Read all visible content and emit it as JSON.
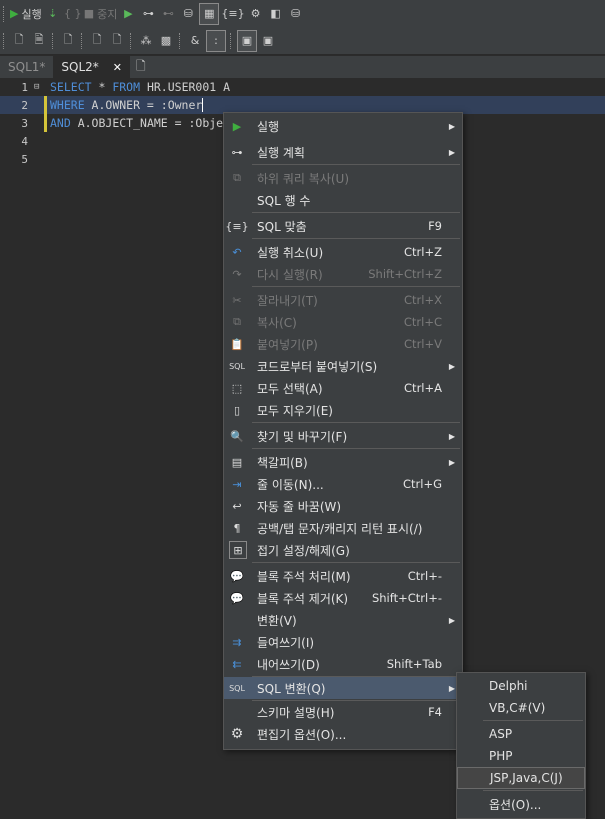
{
  "toolbar1": {
    "run_label": "실행",
    "stop_label": "중지"
  },
  "toolbar2": {
    "amp_label": "&",
    "colon_label": ":"
  },
  "tabs": [
    {
      "label": "SQL1*",
      "active": false
    },
    {
      "label": "SQL2*",
      "active": true
    }
  ],
  "editor": {
    "lines": [
      {
        "num": "1",
        "kw1": "SELECT",
        "t1": " * ",
        "kw2": "FROM",
        "t2": " HR.USER001 A"
      },
      {
        "num": "2",
        "kw1": "WHERE",
        "t1": " A.OWNER = :Owner",
        "kw2": "",
        "t2": ""
      },
      {
        "num": "3",
        "kw1": "AND",
        "t1": " A.OBJECT_NAME = :Obje",
        "kw2": "",
        "t2": ""
      },
      {
        "num": "4",
        "kw1": "",
        "t1": "",
        "kw2": "",
        "t2": ""
      },
      {
        "num": "5",
        "kw1": "",
        "t1": "",
        "kw2": "",
        "t2": ""
      }
    ]
  },
  "context_menu": {
    "items": [
      {
        "label": "실행",
        "shortcut": "",
        "submenu": true,
        "disabled": false,
        "icon": "play-icon"
      },
      {
        "label": "실행 계획",
        "shortcut": "",
        "submenu": true,
        "disabled": false,
        "icon": "plan-icon"
      },
      {
        "label": "하위 쿼리 복사(U)",
        "shortcut": "",
        "submenu": false,
        "disabled": true,
        "icon": "subquery-copy-icon"
      },
      {
        "label": "SQL 행 수",
        "shortcut": "",
        "submenu": false,
        "disabled": false,
        "icon": ""
      },
      {
        "label": "SQL 맞춤",
        "shortcut": "F9",
        "submenu": false,
        "disabled": false,
        "icon": "format-icon"
      },
      {
        "label": "실행 취소(U)",
        "shortcut": "Ctrl+Z",
        "submenu": false,
        "disabled": false,
        "icon": "undo-icon"
      },
      {
        "label": "다시 실행(R)",
        "shortcut": "Shift+Ctrl+Z",
        "submenu": false,
        "disabled": true,
        "icon": "redo-icon"
      },
      {
        "label": "잘라내기(T)",
        "shortcut": "Ctrl+X",
        "submenu": false,
        "disabled": true,
        "icon": "cut-icon"
      },
      {
        "label": "복사(C)",
        "shortcut": "Ctrl+C",
        "submenu": false,
        "disabled": true,
        "icon": "copy-icon"
      },
      {
        "label": "붙여넣기(P)",
        "shortcut": "Ctrl+V",
        "submenu": false,
        "disabled": true,
        "icon": "paste-icon"
      },
      {
        "label": "코드로부터 붙여넣기(S)",
        "shortcut": "",
        "submenu": true,
        "disabled": false,
        "icon": "paste-code-icon"
      },
      {
        "label": "모두 선택(A)",
        "shortcut": "Ctrl+A",
        "submenu": false,
        "disabled": false,
        "icon": "select-all-icon"
      },
      {
        "label": "모두 지우기(E)",
        "shortcut": "",
        "submenu": false,
        "disabled": false,
        "icon": "clear-icon"
      },
      {
        "label": "찾기 및 바꾸기(F)",
        "shortcut": "",
        "submenu": true,
        "disabled": false,
        "icon": "search-icon"
      },
      {
        "label": "책갈피(B)",
        "shortcut": "",
        "submenu": true,
        "disabled": false,
        "icon": "bookmark-icon"
      },
      {
        "label": "줄 이동(N)...",
        "shortcut": "Ctrl+G",
        "submenu": false,
        "disabled": false,
        "icon": "goto-line-icon"
      },
      {
        "label": "자동 줄 바꿈(W)",
        "shortcut": "",
        "submenu": false,
        "disabled": false,
        "icon": "word-wrap-icon"
      },
      {
        "label": "공백/탭 문자/캐리지 리턴 표시(/)",
        "shortcut": "",
        "submenu": false,
        "disabled": false,
        "icon": "pilcrow-icon"
      },
      {
        "label": "접기 설정/해제(G)",
        "shortcut": "",
        "submenu": false,
        "disabled": false,
        "icon": "fold-icon"
      },
      {
        "label": "블록 주석 처리(M)",
        "shortcut": "Ctrl+-",
        "submenu": false,
        "disabled": false,
        "icon": "comment-icon"
      },
      {
        "label": "블록 주석 제거(K)",
        "shortcut": "Shift+Ctrl+-",
        "submenu": false,
        "disabled": false,
        "icon": "uncomment-icon"
      },
      {
        "label": "변환(V)",
        "shortcut": "",
        "submenu": true,
        "disabled": false,
        "icon": ""
      },
      {
        "label": "들여쓰기(I)",
        "shortcut": "",
        "submenu": false,
        "disabled": false,
        "icon": "indent-icon"
      },
      {
        "label": "내어쓰기(D)",
        "shortcut": "Shift+Tab",
        "submenu": false,
        "disabled": false,
        "icon": "outdent-icon"
      },
      {
        "label": "SQL 변환(Q)",
        "shortcut": "",
        "submenu": true,
        "disabled": false,
        "icon": "sql-convert-icon"
      },
      {
        "label": "스키마 설명(H)",
        "shortcut": "F4",
        "submenu": false,
        "disabled": false,
        "icon": ""
      },
      {
        "label": "편집기 옵션(O)...",
        "shortcut": "",
        "submenu": false,
        "disabled": false,
        "icon": "gear-icon"
      }
    ]
  },
  "submenu": {
    "items": [
      {
        "label": "Delphi"
      },
      {
        "label": "VB,C#(V)"
      },
      {
        "label": "ASP"
      },
      {
        "label": "PHP"
      },
      {
        "label": "JSP,Java,C(J)"
      },
      {
        "label": "옵션(O)..."
      }
    ]
  }
}
